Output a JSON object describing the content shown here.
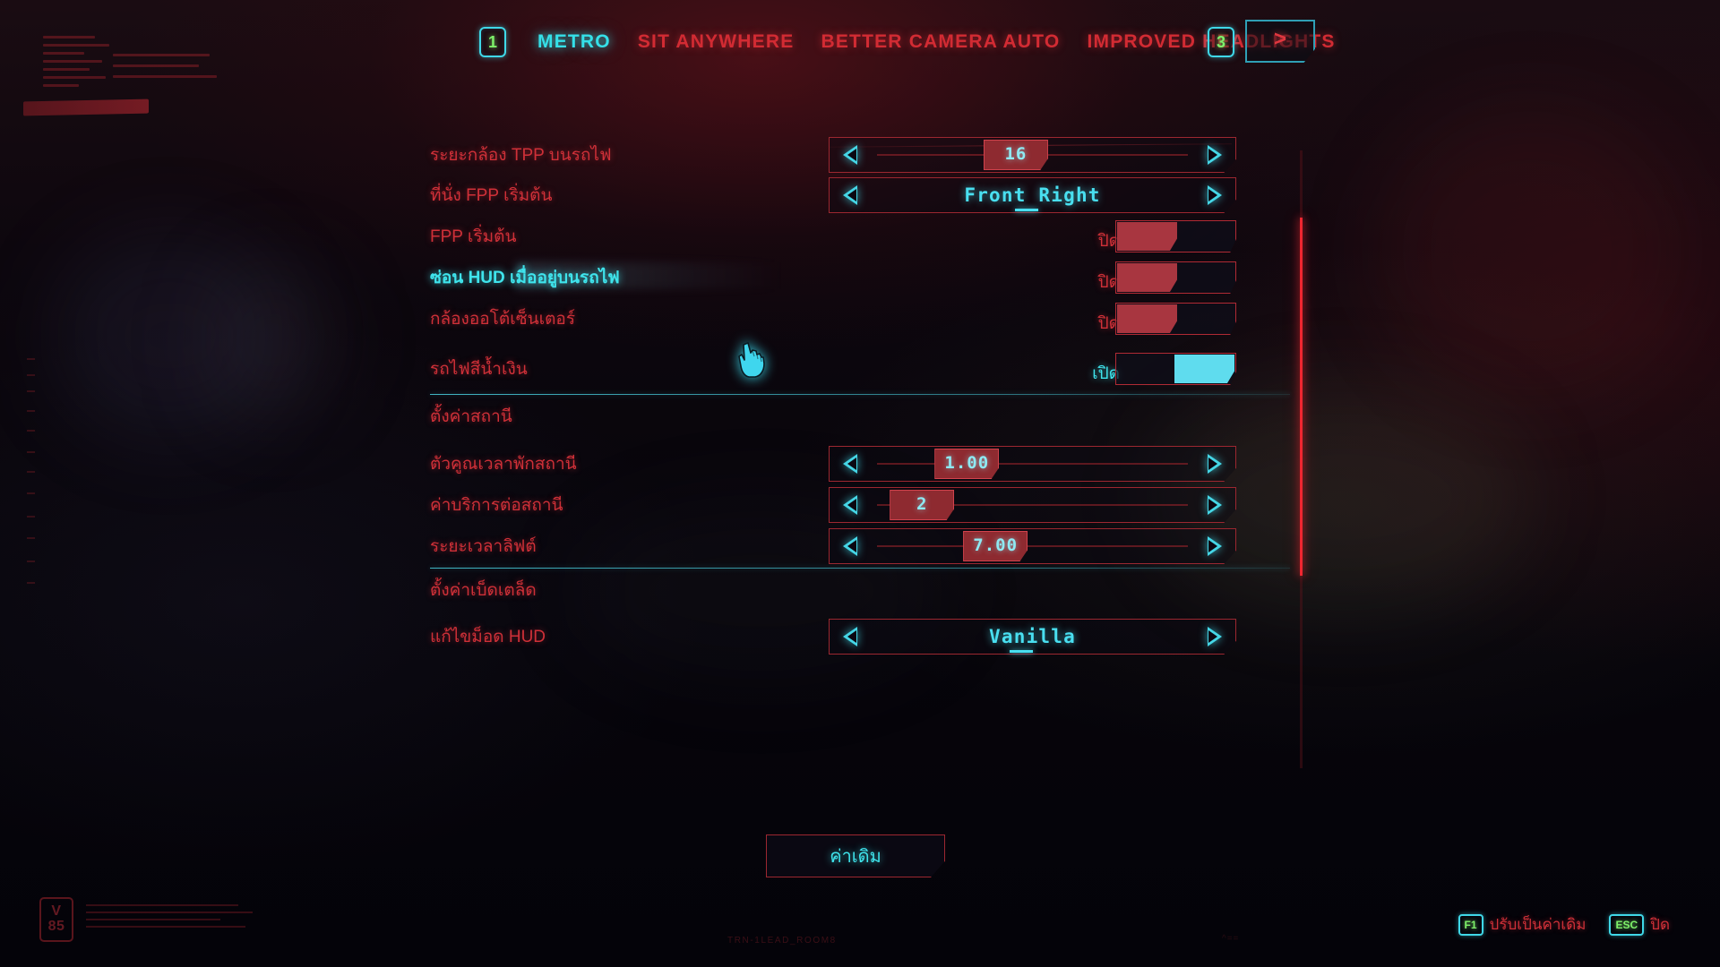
{
  "topbar": {
    "prev_key": "1",
    "next_key": "3",
    "next_page_glyph": ">",
    "tabs": [
      {
        "label": "METRO",
        "active": true
      },
      {
        "label": "SIT ANYWHERE",
        "active": false
      },
      {
        "label": "BETTER CAMERA AUTO",
        "active": false
      },
      {
        "label": "IMPROVED HEADLIGHTS",
        "active": false
      }
    ]
  },
  "settings": {
    "rows": [
      {
        "label": "ระยะกล้อง TPP บนรถไฟ",
        "type": "slider",
        "value": "16",
        "fill_pct": 40,
        "hovered": false
      },
      {
        "label": "ที่นั่ง FPP เริ่มต้น",
        "type": "dropdown",
        "value": "Front Right",
        "hovered": false
      },
      {
        "label": "FPP เริ่มต้น",
        "type": "toggle",
        "state_label": "ปิด",
        "on": false,
        "hovered": false
      },
      {
        "label": "ซ่อน HUD เมื่ออยู่บนรถไฟ",
        "type": "toggle",
        "state_label": "ปิด",
        "on": false,
        "hovered": true
      },
      {
        "label": "กล้องออโต้เซ็นเตอร์",
        "type": "toggle",
        "state_label": "ปิด",
        "on": false,
        "hovered": false
      },
      {
        "label": "รถไฟสีน้ำเงิน",
        "type": "toggle",
        "state_label": "เปิด",
        "on": true,
        "hovered": false
      }
    ]
  },
  "section_station": {
    "title": "ตั้งค่าสถานี",
    "rows": [
      {
        "label": "ตัวคูณเวลาพักสถานี",
        "type": "slider",
        "value": "1.00",
        "fill_pct": 27,
        "hovered": false
      },
      {
        "label": "ค่าบริการต่อสถานี",
        "type": "slider",
        "value": "2",
        "fill_pct": 16,
        "hovered": false
      },
      {
        "label": "ระยะเวลาลิฟต์",
        "type": "slider",
        "value": "7.00",
        "fill_pct": 35,
        "hovered": false
      }
    ]
  },
  "section_misc": {
    "title": "ตั้งค่าเบ็ดเตล็ด",
    "rows": [
      {
        "label": "แก้ไขม็อด HUD",
        "type": "dropdown",
        "value": "Vanilla",
        "hovered": false
      }
    ]
  },
  "defaults_button": {
    "label": "ค่าเดิม"
  },
  "footer": {
    "hints": [
      {
        "key": "F1",
        "label": "ปรับเป็นค่าเดิม"
      },
      {
        "key": "ESC",
        "label": "ปิด"
      }
    ]
  },
  "decor": {
    "version_badge_line1": "V",
    "version_badge_line2": "85",
    "bottom_center_text": "TRN-1LEAD_ROOM8",
    "bottom_right_text": "^=="
  },
  "colors": {
    "accent_red": "#cf3038",
    "accent_cyan": "#3fe4ec",
    "key_green": "#7ef06a",
    "toggle_off": "#a83640",
    "toggle_on": "#5fdcee",
    "scrollbar": "#f02630",
    "background": "#07050b"
  }
}
